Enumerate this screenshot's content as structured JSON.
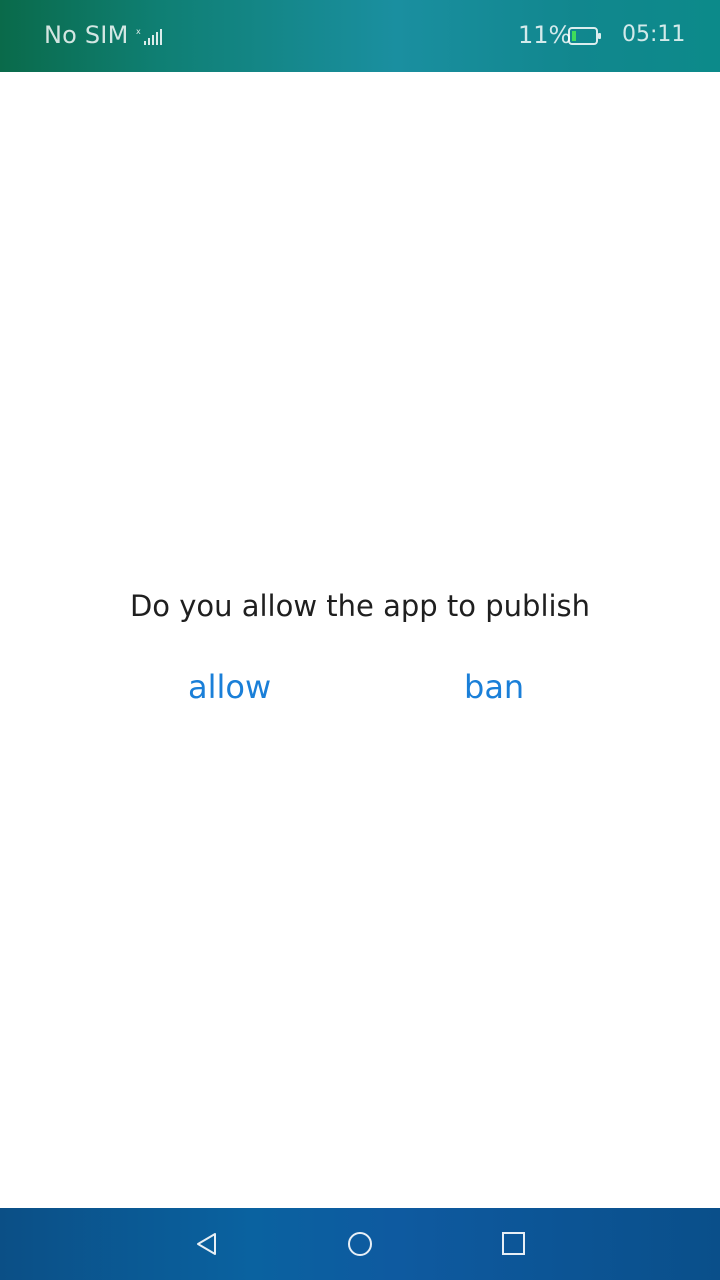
{
  "status_bar": {
    "carrier": "No SIM",
    "signal_icon": "signal-no-sim-icon",
    "battery_percent": "11%",
    "battery_icon": "battery-low-icon",
    "time": "05:11"
  },
  "dialog": {
    "prompt": "Do you allow the app to publish",
    "allow_label": "allow",
    "ban_label": "ban",
    "action_color": "#1a7fd8"
  },
  "nav_bar": {
    "back_icon": "back-triangle-icon",
    "home_icon": "home-circle-icon",
    "recent_icon": "recent-apps-square-icon"
  }
}
